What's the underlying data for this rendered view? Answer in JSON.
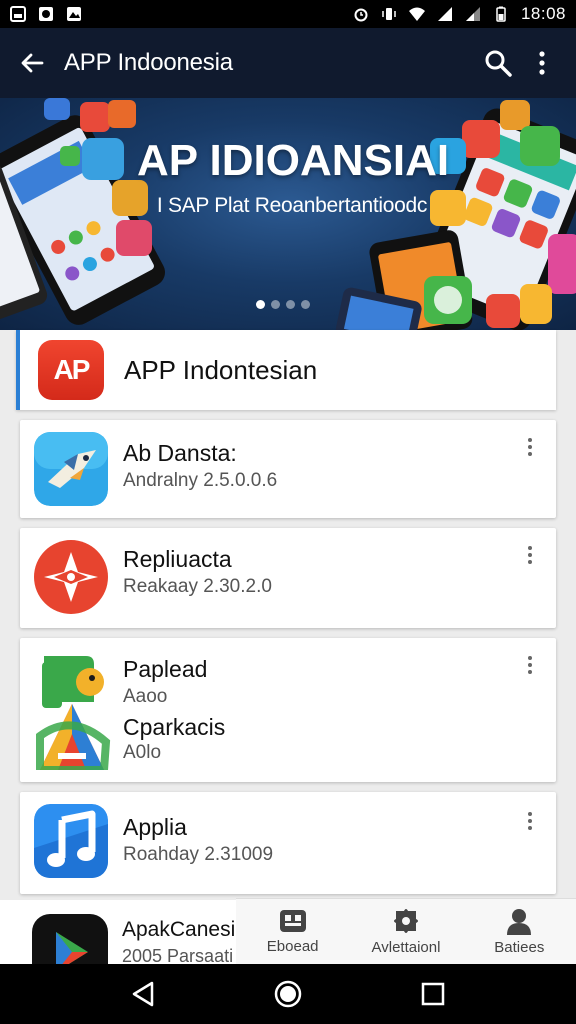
{
  "status_bar": {
    "time": "18:08"
  },
  "app_bar": {
    "title": "APP Indoonesia"
  },
  "banner": {
    "title": "AP IDIOANSIAI",
    "subtitle": "I SAP Plat Reoanbertantioodc"
  },
  "featured": {
    "icon_text": "AP",
    "name": "APP Indontesian"
  },
  "apps": [
    {
      "title": "Ab Dansta:",
      "subtitle": "Andralny 2.5.0.0.6"
    },
    {
      "title": "Repliuacta",
      "subtitle": "Reakaay 2.30.2.0"
    },
    {
      "title": "Paplead",
      "subtitle": "Aaoo",
      "title2": "Cparkacis",
      "subtitle2": "A0lo"
    },
    {
      "title": "Applia",
      "subtitle": "Roahday 2.31009"
    }
  ],
  "bottom_card": {
    "title": "ApakCanesi",
    "subtitle": "2005 Parsaati"
  },
  "bottom_nav": [
    {
      "label": "Eboead",
      "icon": "store-icon"
    },
    {
      "label": "Avlettaionl",
      "icon": "puzzle-icon"
    },
    {
      "label": "Batiees",
      "icon": "person-icon"
    }
  ],
  "colors": {
    "app_bar": "#101a2e",
    "accent": "#2b7fd4",
    "featured_icon": "#e63a27"
  }
}
